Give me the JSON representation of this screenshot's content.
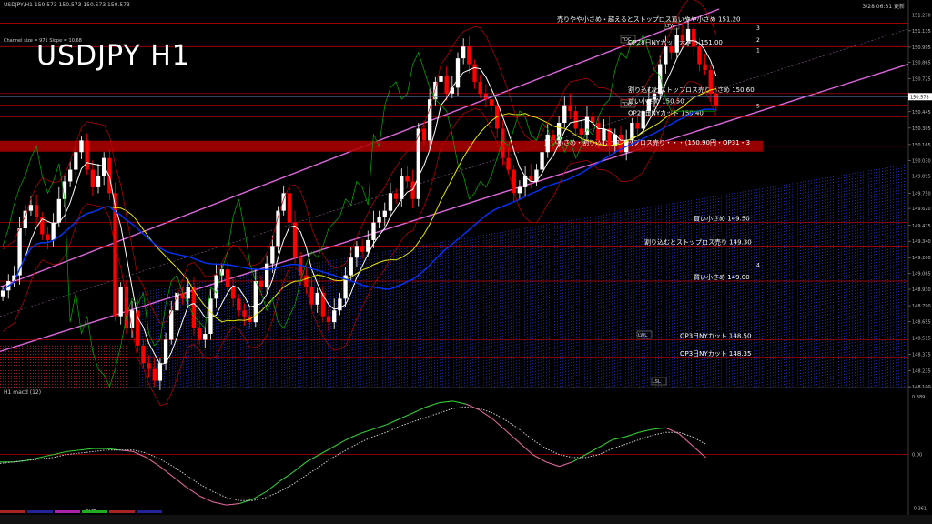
{
  "header": {
    "symbol_line": "USDJPY,H1  150.573 150.573 150.573 150.573",
    "timestamp": "3/28 06:31 更新",
    "big_title": "USDJPY H1",
    "channel_info": "Channel size = 971  Slope = 10.68"
  },
  "colors": {
    "background": "#000000",
    "bull_candle": "#ffffff",
    "bear_candle": "#ff0000",
    "level_line": "#cc0000",
    "channel": "#dd66dd",
    "ma_fast": "#ffffff",
    "ma_mid": "#e6e600",
    "ma_slow": "#0033ff",
    "bollinger": "#c00000",
    "chikou": "#00b000",
    "macd_main": "#33cc33",
    "macd_signal": "#cccccc"
  },
  "chart_data": {
    "type": "line",
    "title": "USDJPY H1",
    "y_axis_ticks": [
      "151.270",
      "151.135",
      "150.995",
      "150.865",
      "150.725",
      "150.573",
      "150.445",
      "150.305",
      "150.165",
      "150.030",
      "149.895",
      "149.750",
      "149.620",
      "149.475",
      "149.340",
      "149.200",
      "149.065",
      "148.930",
      "148.790",
      "148.655",
      "148.515",
      "148.375",
      "148.235",
      "148.100"
    ],
    "ylim": [
      148.1,
      151.32
    ],
    "current_price": "150.573",
    "close_series": [
      148.92,
      149.0,
      149.05,
      149.45,
      149.6,
      149.65,
      149.55,
      149.4,
      149.35,
      149.5,
      149.7,
      149.85,
      149.95,
      150.1,
      150.2,
      149.95,
      149.8,
      149.9,
      150.05,
      149.75,
      148.7,
      148.95,
      148.6,
      148.75,
      148.45,
      148.3,
      148.25,
      148.15,
      148.3,
      148.5,
      148.75,
      148.9,
      148.85,
      148.95,
      148.6,
      148.5,
      148.55,
      148.85,
      149.05,
      149.1,
      148.95,
      148.85,
      148.75,
      148.7,
      148.65,
      149.0,
      148.95,
      149.15,
      149.3,
      149.6,
      149.75,
      149.5,
      149.2,
      149.05,
      148.95,
      148.8,
      148.9,
      148.7,
      148.65,
      148.75,
      148.85,
      149.05,
      149.2,
      149.3,
      149.25,
      149.35,
      149.5,
      149.55,
      149.6,
      149.75,
      149.7,
      149.9,
      149.85,
      149.7,
      150.3,
      150.2,
      150.55,
      150.7,
      150.75,
      150.6,
      150.65,
      150.9,
      151.0,
      150.85,
      150.7,
      150.6,
      150.55,
      150.5,
      150.3,
      150.05,
      149.95,
      149.75,
      149.8,
      149.9,
      149.85,
      149.95,
      150.1,
      150.25,
      150.2,
      150.35,
      150.5,
      150.45,
      150.3,
      150.25,
      150.4,
      150.35,
      150.2,
      150.3,
      150.15,
      150.25,
      150.1,
      150.2,
      150.35,
      150.3,
      150.45,
      150.55,
      150.6,
      150.85,
      151.0,
      150.95,
      151.1,
      151.05,
      151.15,
      151.0,
      150.85,
      150.8,
      150.6,
      150.5
    ],
    "levels": [
      {
        "price": 151.2,
        "label": "売りやや小さめ・超えるとストップロス買いやや小さめ 151.20"
      },
      {
        "price": 151.0,
        "label": "OP28日NYカット大きめ 151.00"
      },
      {
        "price": 150.6,
        "label": "割り込むとストップロス売り小さめ 150.60"
      },
      {
        "price": 150.5,
        "label": "買い小さめ 150.50"
      },
      {
        "price": 150.4,
        "label": "OP28日NYカット 150.40"
      },
      {
        "price": 150.15,
        "label": "買い小さめ・割り込むとストップロス売り・・・（150.90円・OP31・3"
      },
      {
        "price": 149.5,
        "label": "買い小さめ 149.50"
      },
      {
        "price": 149.3,
        "label": "割り込むとストップロス売り 149.30"
      },
      {
        "price": 149.0,
        "label": "買い小さめ 149.00"
      },
      {
        "price": 148.5,
        "label": "OP3日NYカット 148.50"
      },
      {
        "price": 148.35,
        "label": "OP3日NYカット 148.35"
      }
    ],
    "level_numbers": [
      "3",
      "2",
      "1",
      "5",
      "4"
    ],
    "marker_labels": [
      "YDC",
      "LTW",
      "YDO",
      "LWL",
      "LSL"
    ],
    "macd": {
      "title": "H1  macd (12)",
      "ticks": [
        "0.389",
        "0.00",
        "-0.361"
      ],
      "main": [
        -0.05,
        -0.05,
        -0.04,
        -0.02,
        0.0,
        0.02,
        0.03,
        0.04,
        0.04,
        0.03,
        0.02,
        -0.02,
        -0.08,
        -0.15,
        -0.22,
        -0.28,
        -0.32,
        -0.34,
        -0.33,
        -0.3,
        -0.25,
        -0.18,
        -0.12,
        -0.05,
        0.0,
        0.05,
        0.1,
        0.14,
        0.17,
        0.2,
        0.24,
        0.28,
        0.32,
        0.35,
        0.36,
        0.34,
        0.3,
        0.24,
        0.16,
        0.08,
        0.0,
        -0.05,
        -0.08,
        -0.05,
        0.0,
        0.05,
        0.1,
        0.12,
        0.15,
        0.17,
        0.18,
        0.14,
        0.06,
        -0.02
      ],
      "signal": [
        -0.06,
        -0.05,
        -0.04,
        -0.03,
        -0.02,
        0.0,
        0.01,
        0.02,
        0.03,
        0.03,
        0.03,
        0.01,
        -0.03,
        -0.08,
        -0.14,
        -0.2,
        -0.25,
        -0.29,
        -0.31,
        -0.31,
        -0.29,
        -0.25,
        -0.2,
        -0.14,
        -0.08,
        -0.02,
        0.03,
        0.08,
        0.12,
        0.15,
        0.19,
        0.22,
        0.25,
        0.28,
        0.31,
        0.32,
        0.31,
        0.28,
        0.23,
        0.17,
        0.1,
        0.04,
        0.0,
        -0.02,
        -0.02,
        0.0,
        0.04,
        0.07,
        0.1,
        0.13,
        0.15,
        0.15,
        0.12,
        0.07
      ]
    },
    "date_label": "3/28"
  }
}
